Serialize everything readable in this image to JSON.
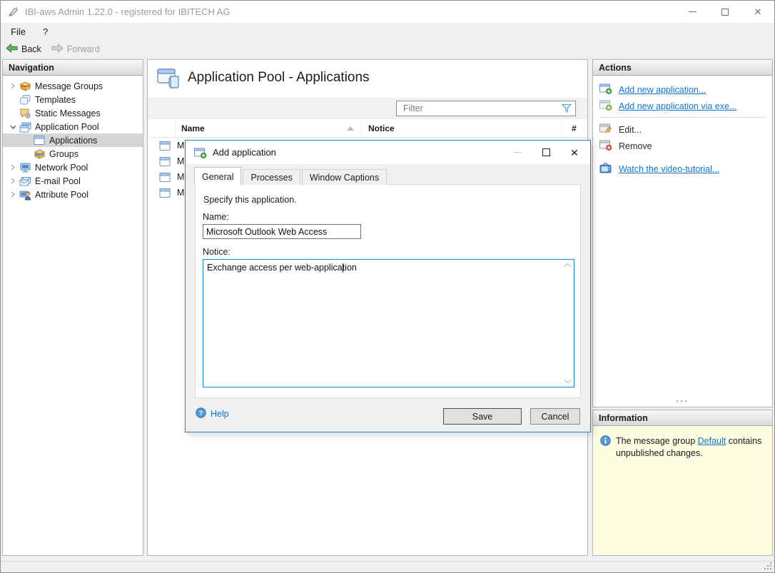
{
  "window": {
    "title": "IBI-aws Admin 1.22.0 - registered for IBITECH AG"
  },
  "menubar": {
    "items": [
      {
        "label": "File"
      },
      {
        "label": "?"
      }
    ]
  },
  "toolbar": {
    "back_label": "Back",
    "forward_label": "Forward"
  },
  "navigation": {
    "header": "Navigation",
    "items": [
      {
        "label": "Message Groups",
        "icon": "message-groups-icon",
        "level": 0,
        "expandable": true,
        "expanded": false,
        "selected": false
      },
      {
        "label": "Templates",
        "icon": "templates-icon",
        "level": 0,
        "expandable": false,
        "selected": false
      },
      {
        "label": "Static Messages",
        "icon": "static-messages-icon",
        "level": 0,
        "expandable": false,
        "selected": false
      },
      {
        "label": "Application Pool",
        "icon": "application-pool-icon",
        "level": 0,
        "expandable": true,
        "expanded": true,
        "selected": false
      },
      {
        "label": "Applications",
        "icon": "applications-icon",
        "level": 1,
        "expandable": false,
        "selected": true
      },
      {
        "label": "Groups",
        "icon": "groups-icon",
        "level": 1,
        "expandable": false,
        "selected": false
      },
      {
        "label": "Network Pool",
        "icon": "network-pool-icon",
        "level": 0,
        "expandable": true,
        "expanded": false,
        "selected": false
      },
      {
        "label": "E-mail Pool",
        "icon": "email-pool-icon",
        "level": 0,
        "expandable": true,
        "expanded": false,
        "selected": false
      },
      {
        "label": "Attribute Pool",
        "icon": "attribute-pool-icon",
        "level": 0,
        "expandable": true,
        "expanded": false,
        "selected": false
      }
    ]
  },
  "main": {
    "title": "Application Pool - Applications",
    "filter_placeholder": "Filter",
    "table": {
      "columns": [
        "Name",
        "Notice",
        "#"
      ],
      "sort": "Name ascending",
      "rows": [
        {
          "name_visible": "M"
        },
        {
          "name_visible": "M"
        },
        {
          "name_visible": "M"
        },
        {
          "name_visible": "M"
        }
      ]
    }
  },
  "actions": {
    "header": "Actions",
    "items": [
      {
        "label": "Add new application...",
        "style": "link"
      },
      {
        "label": "Add new application via exe...",
        "style": "link"
      },
      {
        "label": "Edit...",
        "style": "plain"
      },
      {
        "label": "Remove",
        "style": "plain"
      },
      {
        "label": "Watch the video-tutorial...",
        "style": "link"
      }
    ]
  },
  "information": {
    "header": "Information",
    "text_before": "The message group ",
    "link_text": "Default",
    "text_after": " contains unpublished changes."
  },
  "dialog": {
    "title": "Add application",
    "tabs": [
      {
        "label": "General",
        "active": true
      },
      {
        "label": "Processes",
        "active": false
      },
      {
        "label": "Window Captions",
        "active": false
      }
    ],
    "intro": "Specify this application.",
    "name_label": "Name:",
    "name_value": "Microsoft Outlook Web Access",
    "notice_label": "Notice:",
    "notice_value": "Exchange access per web-application",
    "help_label": "Help",
    "save_label": "Save",
    "cancel_label": "Cancel"
  },
  "colors": {
    "accent_blue": "#1883d7",
    "link_blue": "#1374cf",
    "info_panel_bg": "#fdfce1",
    "selection_gray": "#d5d5d5",
    "success_green": "#47a447",
    "error_red": "#d9534f"
  },
  "icons": {
    "app_logo": "stamp-icon",
    "back": "green-arrow-left",
    "forward": "gray-arrow-right",
    "filter": "funnel-icon",
    "sort": "triangle-up",
    "help": "blue-circle-question",
    "info": "blue-circle-i",
    "add": "window-plus-badge",
    "edit": "window-pencil-badge",
    "remove": "window-x-badge",
    "video": "tv-icon",
    "resize": "grip-dots"
  }
}
